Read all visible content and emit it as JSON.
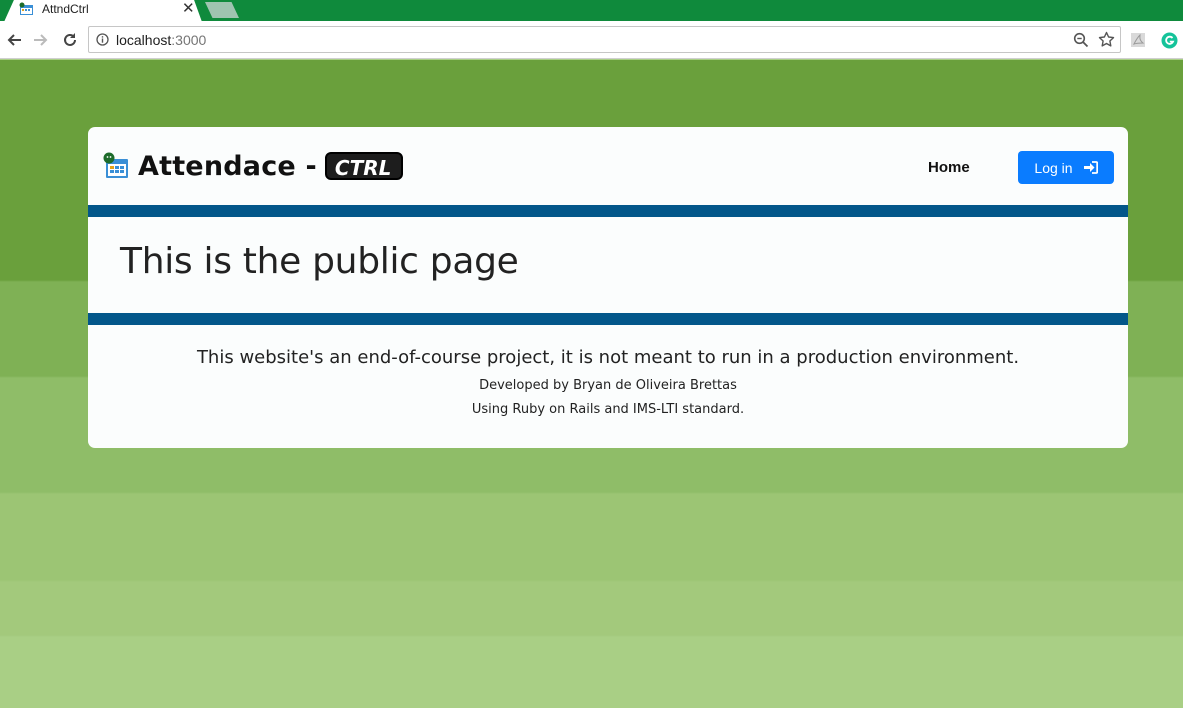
{
  "browser": {
    "tab_title": "AttndCtrl",
    "tab_close": "✕",
    "url_host": "localhost",
    "url_port": ":3000"
  },
  "navbar": {
    "brand_text": "Attendace -",
    "brand_badge": "CTRL",
    "home_link": "Home",
    "login_label": "Log in"
  },
  "hero": {
    "title": "This is the public page"
  },
  "footer": {
    "notice": "This website's an end-of-course project, it is not meant to run in a production environment.",
    "developer": "Developed by Bryan de Oliveira Brettas",
    "tech": "Using Ruby on Rails and IMS-LTI standard."
  },
  "colors": {
    "tabstrip": "#0f8a3c",
    "band": "#03578a",
    "login_button": "#0a7cff",
    "page_green": "#6aa03c"
  },
  "icons": {
    "favicon": "calendar-icon",
    "back": "back-arrow-icon",
    "forward": "forward-arrow-icon",
    "reload": "reload-icon",
    "info": "info-icon",
    "zoom": "zoom-icon",
    "star": "star-icon",
    "pdf_extension": "pdf-extension-icon",
    "grammarly_extension": "grammarly-icon",
    "login": "sign-in-icon"
  }
}
